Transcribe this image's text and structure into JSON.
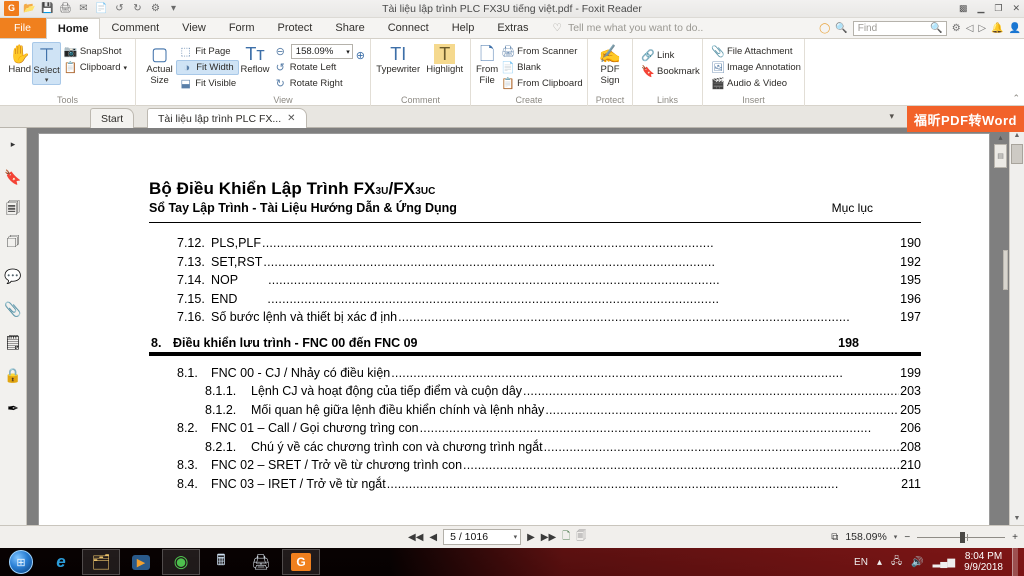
{
  "window": {
    "title": "Tài liệu lập trình PLC FX3U tiếng việt.pdf - Foxit Reader",
    "quick_access": [
      {
        "name": "foxit-logo-icon",
        "glyph": "G"
      },
      {
        "name": "open-icon",
        "glyph": "📂"
      },
      {
        "name": "save-icon",
        "glyph": "💾"
      },
      {
        "name": "print-icon",
        "glyph": "🖨"
      },
      {
        "name": "email-icon",
        "glyph": "✉"
      },
      {
        "name": "create-pdf-icon",
        "glyph": "📄"
      },
      {
        "name": "undo-icon",
        "glyph": "↺"
      },
      {
        "name": "redo-icon",
        "glyph": "↻"
      },
      {
        "name": "customize-icon",
        "glyph": "⚙"
      },
      {
        "name": "more-icon",
        "glyph": "▾"
      }
    ],
    "controls": [
      {
        "name": "grid-layout-icon",
        "glyph": "▩"
      },
      {
        "name": "minimize-button",
        "glyph": "▁"
      },
      {
        "name": "restore-button",
        "glyph": "❐"
      },
      {
        "name": "close-button",
        "glyph": "✕"
      }
    ]
  },
  "menu": {
    "tabs": [
      {
        "label": "File",
        "id": "file"
      },
      {
        "label": "Home",
        "id": "home"
      },
      {
        "label": "Comment",
        "id": "comment"
      },
      {
        "label": "View",
        "id": "view"
      },
      {
        "label": "Form",
        "id": "form"
      },
      {
        "label": "Protect",
        "id": "protect"
      },
      {
        "label": "Share",
        "id": "share"
      },
      {
        "label": "Connect",
        "id": "connect"
      },
      {
        "label": "Help",
        "id": "help"
      },
      {
        "label": "Extras",
        "id": "extras"
      }
    ],
    "active_tab": "Home",
    "tell_me": "Tell me what you want to do..",
    "find_placeholder": "Find",
    "right_icons": [
      {
        "name": "lifebuoy-icon",
        "glyph": "◯"
      },
      {
        "name": "search-document-icon",
        "glyph": "🔍"
      }
    ],
    "after_find_icons": [
      {
        "name": "settings-gear-icon",
        "glyph": "⚙"
      },
      {
        "name": "previous-view-icon",
        "glyph": "◁"
      },
      {
        "name": "next-view-icon",
        "glyph": "▷"
      },
      {
        "name": "notification-bell-icon",
        "glyph": "🔔"
      },
      {
        "name": "account-icon",
        "glyph": "👤"
      }
    ]
  },
  "ribbon": {
    "groups": [
      {
        "title": "Tools",
        "big": [
          {
            "label": "Hand",
            "icon": "hand-icon",
            "glyph": "✋",
            "selected": false
          },
          {
            "label": "Select",
            "icon": "select-text-icon",
            "glyph": "⊤",
            "selected": true
          }
        ],
        "small": [
          {
            "label": "SnapShot",
            "icon": "snapshot-icon",
            "glyph": "📷"
          },
          {
            "label": "Clipboard",
            "icon": "clipboard-icon",
            "glyph": "📋",
            "dropdown": "▾"
          }
        ]
      },
      {
        "title": "View",
        "big": [
          {
            "label": "Actual Size",
            "icon": "actual-size-icon",
            "glyph": "▢"
          },
          {
            "label": "Reflow",
            "icon": "reflow-icon",
            "glyph": "Tт"
          }
        ],
        "small": [
          {
            "label": "Fit Page",
            "icon": "fit-page-icon",
            "glyph": "⬚"
          },
          {
            "label": "Fit Width",
            "icon": "fit-width-icon",
            "glyph": "◑",
            "selected": true
          },
          {
            "label": "Fit Visible",
            "icon": "fit-visible-icon",
            "glyph": "⬓"
          }
        ],
        "zoom_value": "158.09%",
        "zoom_out_icon": "zoom-out-icon",
        "small2": [
          {
            "label": "Rotate Left",
            "icon": "rotate-left-icon",
            "glyph": "↺"
          },
          {
            "label": "Rotate Right",
            "icon": "rotate-right-icon",
            "glyph": "↻"
          }
        ],
        "zoom_in_icon": "zoom-in-icon"
      },
      {
        "title": "Comment",
        "big": [
          {
            "label": "Typewriter",
            "icon": "typewriter-icon",
            "glyph": "TI"
          },
          {
            "label": "Highlight",
            "icon": "highlight-icon",
            "glyph": "T",
            "highlighted": true
          }
        ],
        "small": []
      },
      {
        "title": "Create",
        "big": [
          {
            "label": "From File",
            "icon": "from-file-icon",
            "glyph": "🗋"
          }
        ],
        "small": [
          {
            "label": "From Scanner",
            "icon": "scanner-icon",
            "glyph": "🖨"
          },
          {
            "label": "Blank",
            "icon": "blank-page-icon",
            "glyph": "📄"
          },
          {
            "label": "From Clipboard",
            "icon": "from-clipboard-icon",
            "glyph": "📋"
          }
        ]
      },
      {
        "title": "Protect",
        "big": [
          {
            "label": "PDF Sign",
            "icon": "pdf-sign-icon",
            "glyph": "✍"
          }
        ],
        "small": []
      },
      {
        "title": "Links",
        "big": [],
        "small": [
          {
            "label": "Link",
            "icon": "link-icon",
            "glyph": "🔗"
          },
          {
            "label": "Bookmark",
            "icon": "bookmark-icon",
            "glyph": "🔖"
          }
        ]
      },
      {
        "title": "Insert",
        "big": [],
        "small": [
          {
            "label": "File Attachment",
            "icon": "file-attachment-icon",
            "glyph": "📎"
          },
          {
            "label": "Image Annotation",
            "icon": "image-annotation-icon",
            "glyph": "🖼"
          },
          {
            "label": "Audio & Video",
            "icon": "audio-video-icon",
            "glyph": "🎬"
          }
        ]
      }
    ],
    "collapse_glyph": "⌃"
  },
  "doc_tabs": {
    "tabs": [
      {
        "label": "Start",
        "active": false,
        "closable": false
      },
      {
        "label": "Tài liệu lập trình PLC FX...",
        "active": true,
        "closable": true,
        "close_glyph": "✕"
      }
    ],
    "overflow_glyph": "▾",
    "promo_label": "福昕PDF转Word"
  },
  "left_nav": {
    "items": [
      {
        "name": "expand-panel-icon",
        "glyph": "▸"
      },
      {
        "name": "bookmarks-panel-icon",
        "glyph": "🔖"
      },
      {
        "name": "pages-panel-icon",
        "glyph": "🗐"
      },
      {
        "name": "layers-panel-icon",
        "glyph": "🗇"
      },
      {
        "name": "comments-panel-icon",
        "glyph": "💬"
      },
      {
        "name": "attachments-panel-icon",
        "glyph": "📎"
      },
      {
        "name": "destinations-panel-icon",
        "glyph": "🗒"
      },
      {
        "name": "security-panel-icon",
        "glyph": "🔒"
      },
      {
        "name": "signatures-panel-icon",
        "glyph": "✒"
      }
    ]
  },
  "document": {
    "heading_main": "Bộ Điều Khiển Lập Trình FX",
    "heading_sub1": "3U",
    "heading_mid": "/FX",
    "heading_sub2": "3UC",
    "heading_second": "Sổ Tay Lập Trình - Tài Liệu Hướng Dẫn & Ứng Dụng",
    "heading_right": "Mục lục",
    "toc_top": [
      {
        "num": "7.12.",
        "title": "PLS,PLF",
        "page": "190",
        "level": 1
      },
      {
        "num": "7.13.",
        "title": "SET,RST",
        "page": "192",
        "level": 1
      },
      {
        "num": "7.14.",
        "title": "NOP",
        "page": "195",
        "level": 1
      },
      {
        "num": "7.15.",
        "title": "END",
        "page": "196",
        "level": 1
      },
      {
        "num": "7.16.",
        "title": "Số bước lệnh và thiết bị xác đ ịnh",
        "page": "197",
        "level": 1
      }
    ],
    "section": {
      "num": "8.",
      "title": "Điều khiển lưu trình - FNC 00 đến  FNC 09",
      "page": "198"
    },
    "toc_bottom": [
      {
        "num": "8.1.",
        "title": "FNC 00 - CJ / Nhảy có điều kiện",
        "page": "199",
        "level": 1
      },
      {
        "num": "8.1.1.",
        "title": "Lệnh CJ và hoạt động của tiếp điểm và cuộn dây",
        "page": "203",
        "level": 2
      },
      {
        "num": "8.1.2.",
        "title": "Mối quan hệ giữa lệnh điều khiển chính và lệnh nhảy",
        "page": "205",
        "level": 2
      },
      {
        "num": "8.2.",
        "title": "FNC 01 – Call / Gọi chương trìng con",
        "page": "206",
        "level": 1
      },
      {
        "num": "8.2.1.",
        "title": "Chú ý  về các chương trình con và chương trình ngắt",
        "page": "208",
        "level": 2
      },
      {
        "num": "8.3.",
        "title": "FNC 02 – SRET /  Trở về từ chương trình con",
        "page": "210",
        "level": 1
      },
      {
        "num": "8.4.",
        "title": "FNC 03 – IRET / Trở về từ ngắt",
        "page": "211",
        "level": 1
      }
    ]
  },
  "status": {
    "first_page_icon": "first-page-icon",
    "prev_page_icon": "previous-page-icon",
    "page_value": "5 / 1016",
    "page_dropdown": "▾",
    "next_page_icon": "next-page-icon",
    "last_page_icon": "last-page-icon",
    "single_page_icon": "single-page-view-icon",
    "continuous_icon": "continuous-view-icon",
    "fit_icon": "fit-page-status-icon",
    "zoom_value": "158.09%",
    "zoom_dropdown": "▾",
    "zoom_out": "−",
    "zoom_in": "+"
  },
  "taskbar": {
    "items": [
      {
        "name": "start-orb",
        "glyph": "⊞"
      },
      {
        "name": "internet-explorer-icon",
        "glyph": "e"
      },
      {
        "name": "file-explorer-icon",
        "glyph": "🗂"
      },
      {
        "name": "media-player-icon",
        "glyph": "▶"
      },
      {
        "name": "google-chrome-icon",
        "glyph": "◉"
      },
      {
        "name": "calculator-icon",
        "glyph": "🖩"
      },
      {
        "name": "printer-icon",
        "glyph": "🖨"
      },
      {
        "name": "foxit-reader-taskbar-icon",
        "glyph": "G"
      }
    ],
    "tray": {
      "language": "EN",
      "show_hidden_icon": "show-hidden-icons-arrow",
      "show_hidden_glyph": "▴",
      "network_icon": "network-disconnected-icon",
      "volume_icon": "volume-icon",
      "signal_icon": "signal-bars-icon",
      "time": "8:04 PM",
      "date": "9/9/2018"
    }
  }
}
